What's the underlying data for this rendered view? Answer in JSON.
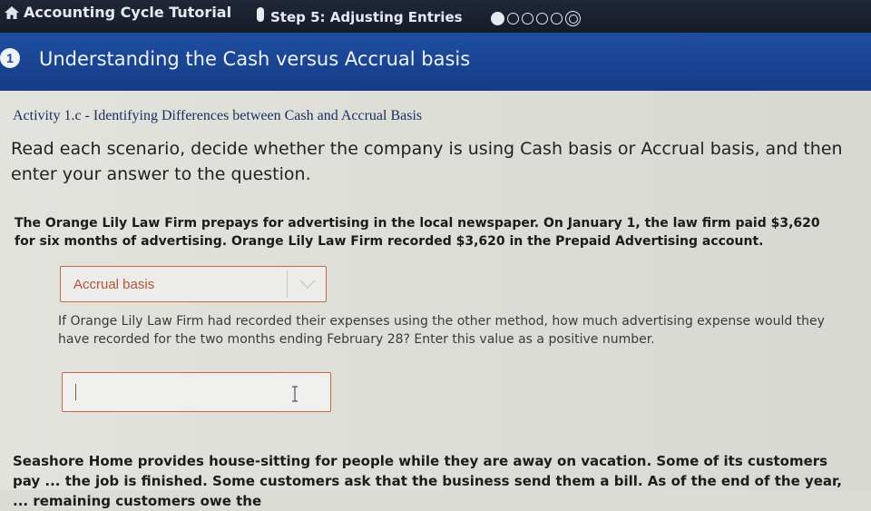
{
  "header": {
    "app_title": "Accounting Cycle Tutorial",
    "step_label": "Step 5: Adjusting Entries",
    "home_icon": "home-icon",
    "progress": {
      "total": 6,
      "completed": 1,
      "current": 6
    }
  },
  "banner": {
    "number": "1",
    "title": "Understanding the Cash versus Accrual basis"
  },
  "activity": {
    "title": "Activity 1.c - Identifying Differences between Cash and Accrual Basis",
    "instructions": "Read each scenario, decide whether the company is using Cash basis or Accrual basis, and then enter your answer to the question."
  },
  "scenario1": {
    "text": "The Orange Lily Law Firm prepays for advertising in the local newspaper. On January 1, the law firm paid $3,620 for six months of advertising. Orange Lily Law Firm recorded $3,620 in the Prepaid Advertising account.",
    "select_value": "Accrual basis",
    "question": "If Orange Lily Law Firm had recorded their expenses using the other method, how much advertising expense would they have recorded for the two months ending February 28? Enter this value as a positive number.",
    "answer_value": ""
  },
  "scenario2": {
    "text": "Seashore Home provides house-sitting for people while they are away on vacation. Some of its customers pay ... the job is finished. Some customers ask that the business send them a bill. As of the end of the year, ... remaining customers owe the"
  },
  "colors": {
    "topbar": "#1a2130",
    "banner": "#1c4796",
    "field_border": "#c56a43",
    "select_text": "#b2553a"
  }
}
